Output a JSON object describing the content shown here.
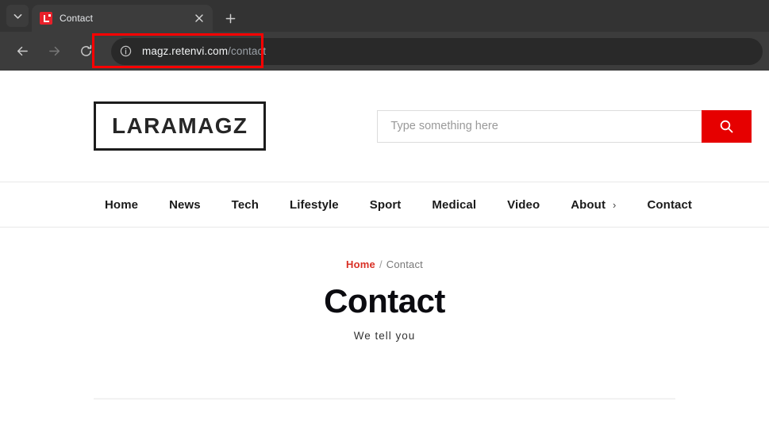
{
  "browser": {
    "tab_search_icon": "chevron-down-icon",
    "tab": {
      "title": "Contact",
      "favicon": "laravel-logo-icon",
      "close_icon": "close-icon"
    },
    "new_tab_icon": "plus-icon",
    "toolbar": {
      "back_icon": "back-arrow-icon",
      "forward_icon": "forward-arrow-icon",
      "reload_icon": "reload-icon",
      "site_info_icon": "info-circle-icon"
    },
    "omnibox": {
      "host": "magz.retenvi.com",
      "path": "/contact",
      "highlight_color": "#ff0000"
    }
  },
  "site": {
    "logo": "LARAMAGZ",
    "search": {
      "placeholder": "Type something here",
      "value": "",
      "button_icon": "search-icon",
      "button_color": "#e60000"
    },
    "nav": [
      {
        "label": "Home",
        "has_chevron": false
      },
      {
        "label": "News",
        "has_chevron": false
      },
      {
        "label": "Tech",
        "has_chevron": false
      },
      {
        "label": "Lifestyle",
        "has_chevron": false
      },
      {
        "label": "Sport",
        "has_chevron": false
      },
      {
        "label": "Medical",
        "has_chevron": false
      },
      {
        "label": "Video",
        "has_chevron": false
      },
      {
        "label": "About",
        "has_chevron": true,
        "chevron": "›"
      },
      {
        "label": "Contact",
        "has_chevron": false
      }
    ],
    "hero": {
      "breadcrumb": {
        "link": "Home",
        "separator": "/",
        "current": "Contact",
        "link_color": "#d93025"
      },
      "title": "Contact",
      "subtitle": "We tell you"
    }
  }
}
